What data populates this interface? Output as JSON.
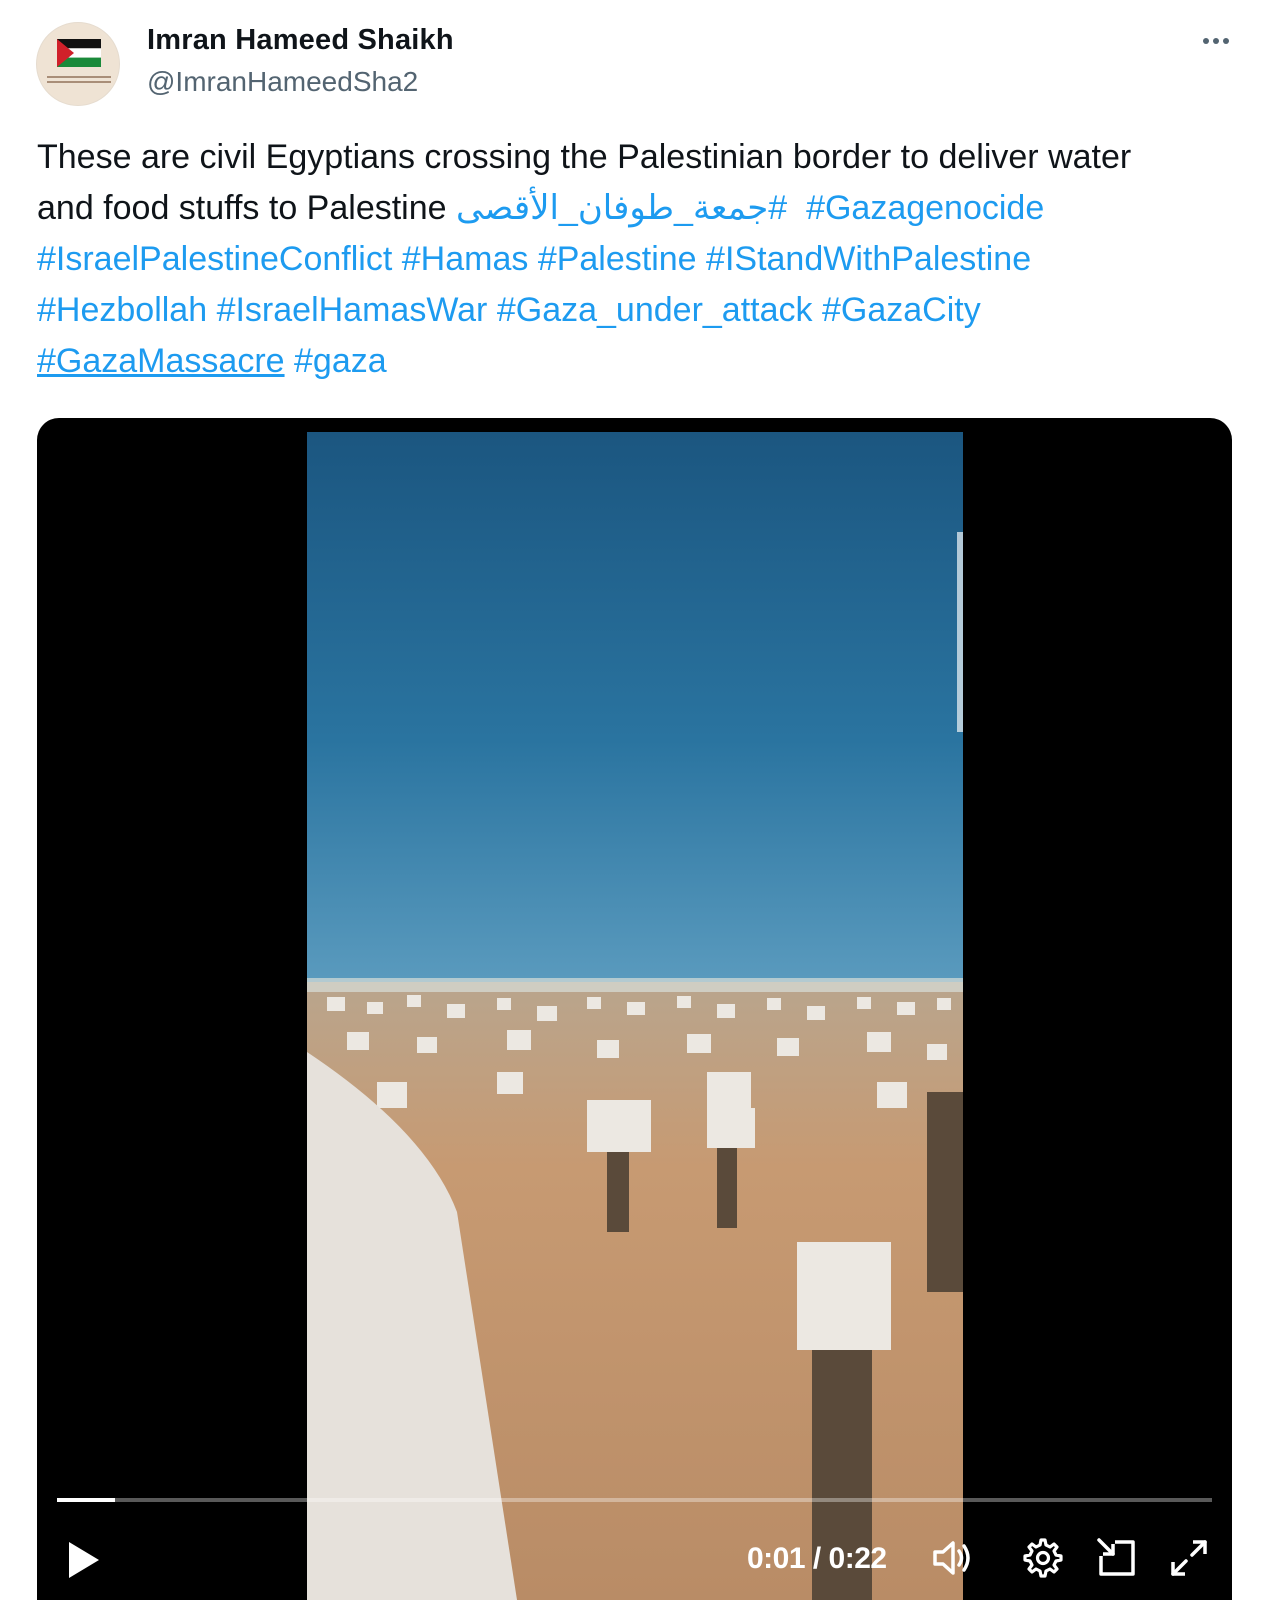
{
  "author": {
    "name": "Imran Hameed Shaikh",
    "handle": "@ImranHameedSha2"
  },
  "menu": {
    "more_icon": "more-horizontal-icon"
  },
  "tweet": {
    "text_intro_1": "These are civil Egyptians crossing the Palestinian border to deliver water",
    "text_intro_2": "and food stuffs to Palestine",
    "hashtags": [
      "#جمعة_طوفان_الأقصى",
      "#Gazagenocide",
      "#IsraelPalestineConflict",
      "#Hamas",
      "#Palestine",
      "#IStandWithPalestine",
      "#Hezbollah",
      "#IsraelHamasWar",
      "#Gaza_under_attack",
      "#GazaCity",
      "#GazaMassacre",
      "#gaza"
    ]
  },
  "video": {
    "time": "0:01 / 0:22",
    "progress": 0.05,
    "controls": {
      "play_icon": "play-icon",
      "volume_icon": "volume-icon",
      "settings_icon": "gear-icon",
      "pip_icon": "picture-in-picture-icon",
      "fullscreen_icon": "fullscreen-icon"
    }
  },
  "colors": {
    "link": "#1d9bf0",
    "text": "#0f1419",
    "secondary": "#536471",
    "media_bg": "#000000"
  }
}
